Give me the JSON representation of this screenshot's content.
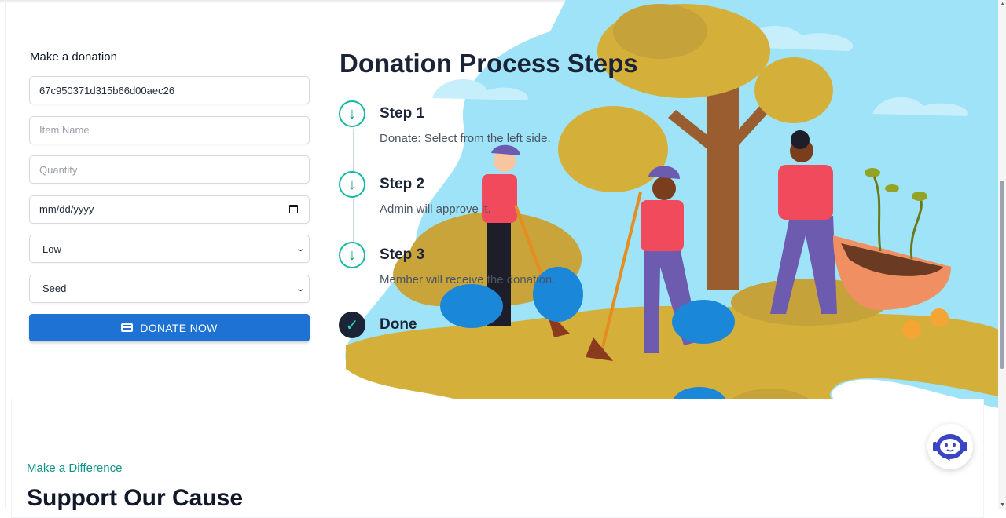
{
  "form": {
    "title": "Make a donation",
    "id_value": "67c950371d315b66d00aec26",
    "item_name_placeholder": "Item Name",
    "quantity_placeholder": "Quantity",
    "date_placeholder": "mm/dd/yyyy",
    "priority_value": "Low",
    "category_value": "Seed",
    "donate_label": "DONATE NOW"
  },
  "steps": {
    "title": "Donation Process Steps",
    "items": [
      {
        "label": "Step 1",
        "desc": "Donate: Select from the left side."
      },
      {
        "label": "Step 2",
        "desc": "Admin will approve it."
      },
      {
        "label": "Step 3",
        "desc": "Member will receive the donation."
      },
      {
        "label": "Done",
        "desc": ""
      }
    ]
  },
  "section": {
    "eyebrow": "Make a Difference",
    "title": "Support Our Cause"
  },
  "icons": {
    "step": "arrow-down-icon",
    "done": "check-icon",
    "donate": "credit-card-icon",
    "chat": "chatbot-icon",
    "date": "calendar-icon",
    "select": "chevron-down-icon"
  },
  "colors": {
    "accent": "#14b8a6",
    "primary_button": "#1d72d4",
    "heading": "#1b2336",
    "eyebrow": "#0f9488",
    "sky": "#9ee3f7",
    "ground": "#d4b03a"
  }
}
